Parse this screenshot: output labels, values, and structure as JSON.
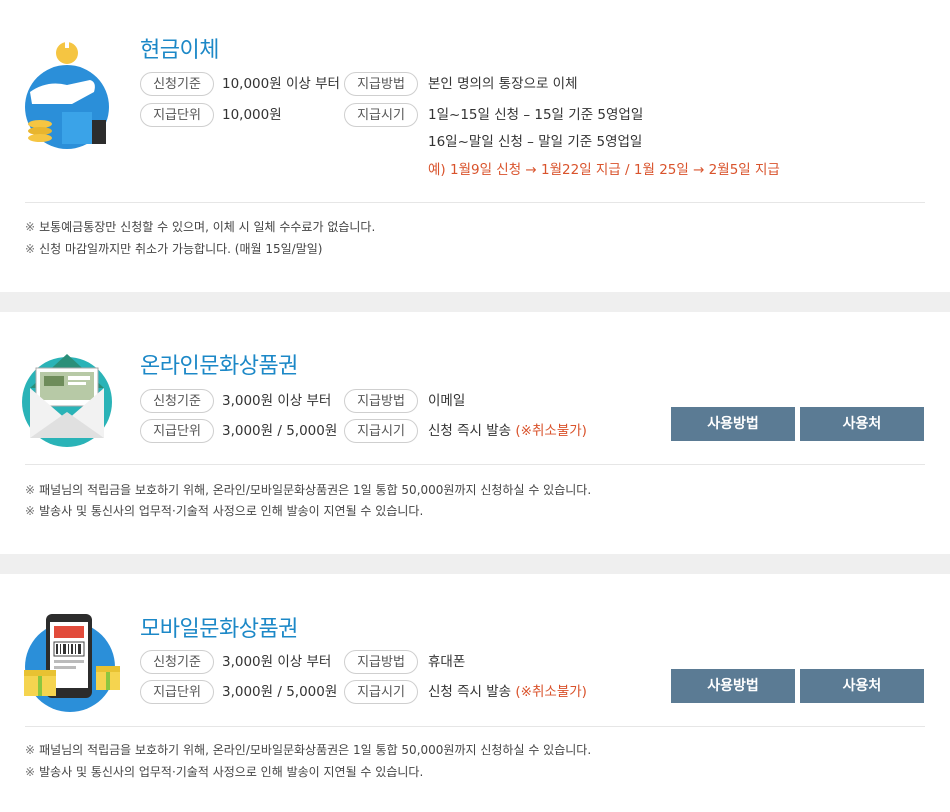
{
  "sections": [
    {
      "title": "현금이체",
      "labels": {
        "criteria": "신청기준",
        "unit": "지급단위",
        "method": "지급방법",
        "timing": "지급시기"
      },
      "criteria_value": "10,000원 이상 부터",
      "unit_value": "10,000원",
      "method_value": "본인 명의의 통장으로 이체",
      "timing_lines": [
        "1일~15일 신청 – 15일 기준 5영업일",
        "16일~말일 신청 – 말일 기준 5영업일"
      ],
      "example": "예) 1월9일 신청 → 1월22일 지급 / 1월 25일 → 2월5일 지급",
      "notes": [
        "보통예금통장만 신청할 수 있으며, 이체 시 일체 수수료가 없습니다.",
        "신청 마감일까지만 취소가 가능합니다. (매월 15일/말일)"
      ],
      "icon": "cash-transfer-icon"
    },
    {
      "title": "온라인문화상품권",
      "labels": {
        "criteria": "신청기준",
        "unit": "지급단위",
        "method": "지급방법",
        "timing": "지급시기"
      },
      "criteria_value": "3,000원 이상 부터",
      "unit_value": "3,000원 / 5,000원",
      "method_value": "이메일",
      "timing_value": "신청 즉시 발송",
      "timing_note": "(※취소불가)",
      "buttons": {
        "howto": "사용방법",
        "where": "사용처"
      },
      "notes": [
        "패널님의 적립금을 보호하기 위해, 온라인/모바일문화상품권은 1일 통합 50,000원까지 신청하실 수 있습니다.",
        "발송사 및 통신사의 업무적·기술적 사정으로 인해 발송이 지연될 수 있습니다."
      ],
      "icon": "email-voucher-icon"
    },
    {
      "title": "모바일문화상품권",
      "labels": {
        "criteria": "신청기준",
        "unit": "지급단위",
        "method": "지급방법",
        "timing": "지급시기"
      },
      "criteria_value": "3,000원 이상 부터",
      "unit_value": "3,000원 / 5,000원",
      "method_value": "휴대폰",
      "timing_value": "신청 즉시 발송",
      "timing_note": "(※취소불가)",
      "buttons": {
        "howto": "사용방법",
        "where": "사용처"
      },
      "notes": [
        "패널님의 적립금을 보호하기 위해, 온라인/모바일문화상품권은 1일 통합 50,000원까지 신청하실 수 있습니다.",
        "발송사 및 통신사의 업무적·기술적 사정으로 인해 발송이 지연될 수 있습니다."
      ],
      "icon": "mobile-voucher-icon"
    }
  ],
  "note_mark": "※",
  "colors": {
    "title": "#1c88c7",
    "button": "#5b7b94",
    "accent_red": "#d9532c",
    "gap": "#efefef"
  }
}
